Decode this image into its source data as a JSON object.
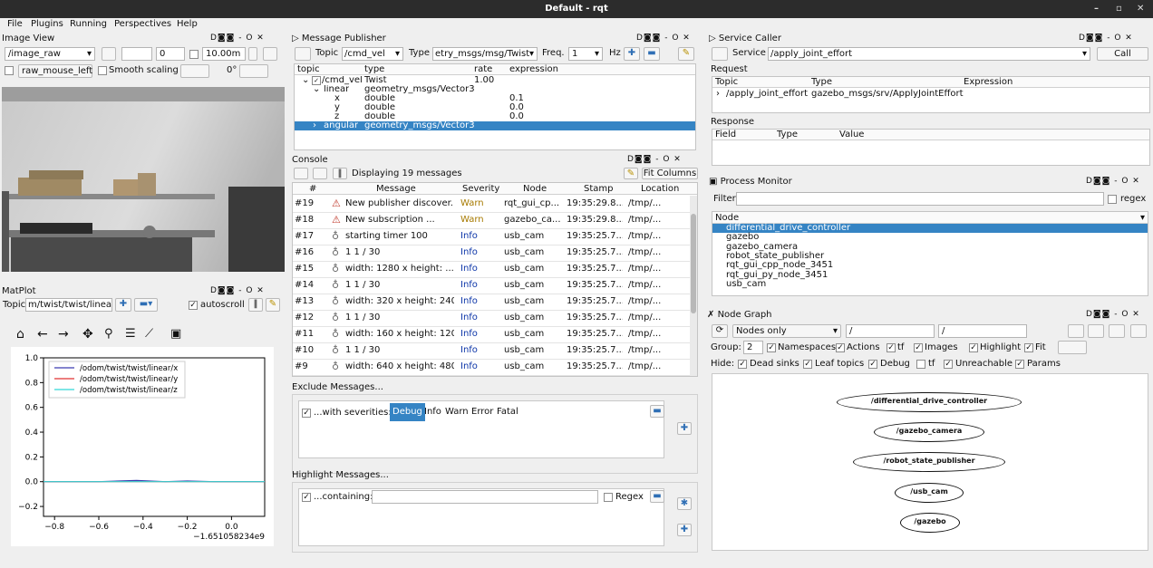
{
  "window": {
    "title": "Default - rqt"
  },
  "menu": [
    "File",
    "Plugins",
    "Running",
    "Perspectives",
    "Help"
  ],
  "image_view": {
    "title": "Image View",
    "topic": "/image_raw",
    "spin_value": "0",
    "distance": "10.00m",
    "mouse_topic": "raw_mouse_left",
    "smooth_label": "Smooth scaling",
    "rotation": "0°"
  },
  "matplot": {
    "title": "MatPlot",
    "topic_label": "Topic",
    "topic": "m/twist/twist/linear",
    "autoscroll": "autoscroll"
  },
  "chart_data": {
    "type": "line",
    "series": [
      {
        "name": "/odom/twist/twist/linear/x",
        "color": "#3b3bb0",
        "x": [
          -0.85,
          -0.6,
          -0.43,
          -0.3,
          -0.2,
          -0.08,
          0.15
        ],
        "y": [
          0,
          0,
          0.01,
          0,
          0.005,
          0,
          0
        ]
      },
      {
        "name": "/odom/twist/twist/linear/y",
        "color": "#e03030",
        "x": [
          -0.85,
          0.15
        ],
        "y": [
          0,
          0
        ]
      },
      {
        "name": "/odom/twist/twist/linear/z",
        "color": "#30d8d8",
        "x": [
          -0.85,
          0.15
        ],
        "y": [
          0,
          0
        ]
      }
    ],
    "xlim": [
      -0.85,
      0.15
    ],
    "ylim": [
      -0.28,
      1.0
    ],
    "xticks": [
      -0.8,
      -0.6,
      -0.4,
      -0.2,
      0.0
    ],
    "xtick_labels": [
      "−0.8",
      "−0.6",
      "−0.4",
      "−0.2",
      "0.0"
    ],
    "yticks": [
      1.0,
      0.8,
      0.6,
      0.4,
      0.2,
      0.0,
      -0.2
    ],
    "ytick_labels": [
      "1.0",
      "0.8",
      "0.6",
      "0.4",
      "0.2",
      "0.0",
      "−0.2"
    ],
    "offset_label": "−1.651058234e9",
    "legend": "top-left",
    "grid": false
  },
  "message_publisher": {
    "title": "Message Publisher",
    "topic_label": "Topic",
    "topic": "/cmd_vel",
    "type_label": "Type",
    "type": "etry_msgs/msg/Twist",
    "freq_label": "Freq.",
    "freq": "1",
    "hz": "Hz",
    "headers": [
      "topic",
      "type",
      "rate",
      "expression"
    ],
    "rows": [
      {
        "topic": "/cmd_vel",
        "type": "Twist",
        "rate": "1.00",
        "expr": ""
      },
      {
        "topic": "linear",
        "type": "geometry_msgs/Vector3",
        "rate": "",
        "expr": ""
      },
      {
        "topic": "x",
        "type": "double",
        "rate": "",
        "expr": "0.1"
      },
      {
        "topic": "y",
        "type": "double",
        "rate": "",
        "expr": "0.0"
      },
      {
        "topic": "z",
        "type": "double",
        "rate": "",
        "expr": "0.0"
      },
      {
        "topic": "angular",
        "type": "geometry_msgs/Vector3",
        "rate": "",
        "expr": ""
      }
    ]
  },
  "console": {
    "title": "Console",
    "status": "Displaying 19 messages",
    "fit": "Fit Columns",
    "headers": [
      "#",
      "Message",
      "Severity",
      "Node",
      "Stamp",
      "Location"
    ],
    "rows": [
      {
        "num": "#19",
        "msg": "New publisher discover...",
        "sev": "Warn",
        "node": "rqt_gui_cp...",
        "stamp": "19:35:29.8...",
        "loc": "/tmp/..."
      },
      {
        "num": "#18",
        "msg": "New subscription ...",
        "sev": "Warn",
        "node": "gazebo_ca...",
        "stamp": "19:35:29.8...",
        "loc": "/tmp/..."
      },
      {
        "num": "#17",
        "msg": "starting timer 100",
        "sev": "Info",
        "node": "usb_cam",
        "stamp": "19:35:25.7...",
        "loc": "/tmp/..."
      },
      {
        "num": "#16",
        "msg": "1 1 / 30",
        "sev": "Info",
        "node": "usb_cam",
        "stamp": "19:35:25.7...",
        "loc": "/tmp/..."
      },
      {
        "num": "#15",
        "msg": "width: 1280 x height: ...",
        "sev": "Info",
        "node": "usb_cam",
        "stamp": "19:35:25.7...",
        "loc": "/tmp/..."
      },
      {
        "num": "#14",
        "msg": "1 1 / 30",
        "sev": "Info",
        "node": "usb_cam",
        "stamp": "19:35:25.7...",
        "loc": "/tmp/..."
      },
      {
        "num": "#13",
        "msg": "width: 320 x height: 240",
        "sev": "Info",
        "node": "usb_cam",
        "stamp": "19:35:25.7...",
        "loc": "/tmp/..."
      },
      {
        "num": "#12",
        "msg": "1 1 / 30",
        "sev": "Info",
        "node": "usb_cam",
        "stamp": "19:35:25.7...",
        "loc": "/tmp/..."
      },
      {
        "num": "#11",
        "msg": "width: 160 x height: 120",
        "sev": "Info",
        "node": "usb_cam",
        "stamp": "19:35:25.7...",
        "loc": "/tmp/..."
      },
      {
        "num": "#10",
        "msg": "1 1 / 30",
        "sev": "Info",
        "node": "usb_cam",
        "stamp": "19:35:25.7...",
        "loc": "/tmp/..."
      },
      {
        "num": "#9",
        "msg": "width: 640 x height: 480",
        "sev": "Info",
        "node": "usb_cam",
        "stamp": "19:35:25.7...",
        "loc": "/tmp/..."
      }
    ],
    "exclude_title": "Exclude Messages...",
    "exclude_label": "...with severities:",
    "severities": [
      "Debug",
      "Info",
      "Warn",
      "Error",
      "Fatal"
    ],
    "highlight_title": "Highlight Messages...",
    "containing": "...containing:",
    "regex": "Regex"
  },
  "service_caller": {
    "title": "Service Caller",
    "service_label": "Service",
    "service": "/apply_joint_effort",
    "call": "Call",
    "request": "Request",
    "req_headers": [
      "Topic",
      "Type",
      "Expression"
    ],
    "req_topic": "/apply_joint_effort",
    "req_type": "gazebo_msgs/srv/ApplyJointEffort",
    "response": "Response",
    "resp_headers": [
      "Field",
      "Type",
      "Value"
    ]
  },
  "process_monitor": {
    "title": "Process Monitor",
    "filter": "Filter",
    "regex": "regex",
    "node_header": "Node",
    "nodes": [
      "differential_drive_controller",
      "gazebo",
      "gazebo_camera",
      "robot_state_publisher",
      "rqt_gui_cpp_node_3451",
      "rqt_gui_py_node_3451",
      "usb_cam"
    ]
  },
  "node_graph": {
    "title": "Node Graph",
    "mode": "Nodes only",
    "filter1": "/",
    "filter2": "/",
    "group_label": "Group:",
    "group": "2",
    "group_opts": [
      "Namespaces",
      "Actions",
      "tf",
      "Images",
      "Highlight",
      "Fit"
    ],
    "hide_label": "Hide:",
    "hide_opts": [
      "Dead sinks",
      "Leaf topics",
      "Debug",
      "tf",
      "Unreachable",
      "Params"
    ],
    "nodes": [
      "/differential_drive_controller",
      "/gazebo_camera",
      "/robot_state_publisher",
      "/usb_cam",
      "/gazebo"
    ]
  }
}
